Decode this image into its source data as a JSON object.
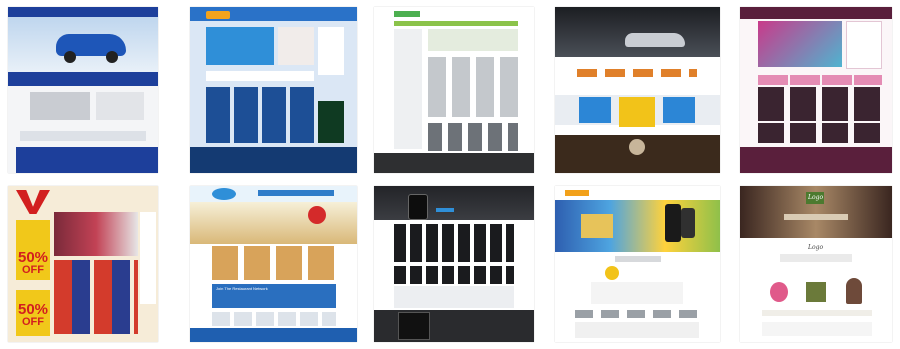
{
  "thumbnails": [
    {
      "label": "Car dealer website template"
    },
    {
      "label": "Blue portal website template"
    },
    {
      "label": "Online electronics shop template"
    },
    {
      "label": "Dark car website template"
    },
    {
      "label": "Beauty salon website template"
    },
    {
      "label": "Fashion sale website template"
    },
    {
      "label": "Restaurant website template"
    },
    {
      "label": "Mobile phone store template"
    },
    {
      "label": "Mobile app showcase template"
    },
    {
      "label": "Spa website template"
    }
  ],
  "texts": {
    "sale_percent_1": "50%",
    "sale_off_1": "OFF",
    "sale_percent_2": "50%",
    "sale_off_2": "OFF",
    "spa_logo": "Logo",
    "spa_logo_2": "Logo",
    "restaurant_heading": "Join The Restaurant Network"
  },
  "colors": {
    "car_blue": "#1d3f9b",
    "portal_navy": "#143a72",
    "salon_purple": "#5a1f3c",
    "sale_red": "#d21f1f",
    "app_yellow": "#f2c319",
    "sky_blue": "#2f8fd8"
  }
}
